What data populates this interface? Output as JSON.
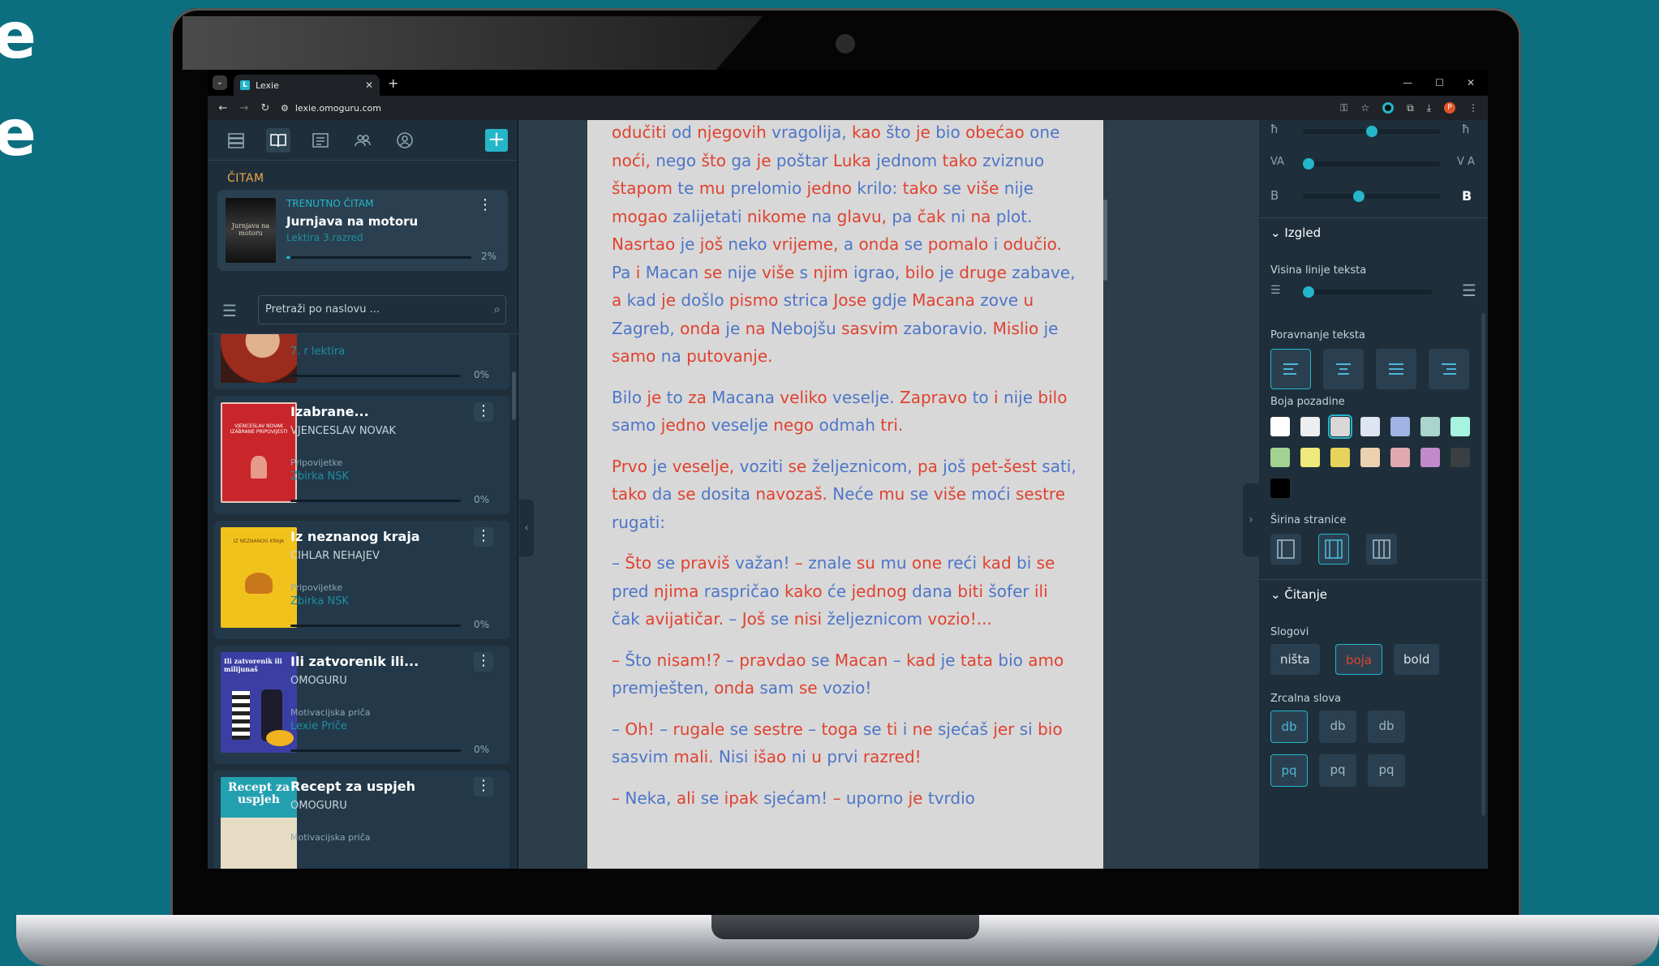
{
  "brand_colors": {
    "accent": "#25b6c9",
    "section_orange": "#f0a64a",
    "text_red": "#e0422f",
    "text_blue": "#4d76c8"
  },
  "browser": {
    "tab_title": "Lexie",
    "tab_favicon": "L",
    "url": "lexie.omoguru.com",
    "profile_initial": "P"
  },
  "sidebar": {
    "section_label": "ČITAM",
    "current": {
      "label": "TRENUTNO ČITAM",
      "title": "Jurnjava na motoru",
      "subtitle": "Lektira 3.razred",
      "progress": 2,
      "progress_label": "2%"
    },
    "search_placeholder": "Pretraži po naslovu ...",
    "books": [
      {
        "title": "",
        "author": "",
        "genre": "",
        "collection": "7. r lektira",
        "progress_label": "0%"
      },
      {
        "title": "Izabrane...",
        "author": "VJENCESLAV NOVAK",
        "genre": "Pripovijetke",
        "collection": "Zbirka NSK",
        "progress_label": "0%"
      },
      {
        "title": "Iz neznanog kraja",
        "author": "CIHLAR NEHAJEV",
        "genre": "Pripovijetke",
        "collection": "Zbirka NSK",
        "progress_label": "0%"
      },
      {
        "title": "Ili zatvorenik ili...",
        "author": "OMOGURU",
        "genre": "Motivacijska priča",
        "collection": "Lexie Priče",
        "progress_label": "0%"
      },
      {
        "title": "Recept za uspjeh",
        "author": "OMOGURU",
        "genre": "Motivacijska priča",
        "collection": "",
        "progress_label": ""
      }
    ],
    "cover_texts": {
      "current": "Jurnjava na motoru",
      "book2": "VJENCESLAV NOVAK IZABRANE PRIPOVIJESTI",
      "book3": "IZ NEZNANOG KRAJA",
      "book4": "Ili zatvorenik ili milijunaš",
      "book5": "Recept za uspjeh"
    }
  },
  "reader": {
    "paragraphs": [
      [
        "odučiti od njegovih vragolija, kao što je bio obećao one noći, nego što ga je poštar Luka jednom tako zviznuo štapom te mu prelomio jedno krilo: tako se više nije mogao zalijetati nikome na glavu, pa čak ni na plot. ",
        "Nasrtao je još neko vrijeme, a onda se pomalo i odučio. ",
        "Pa i Macan se nije više s njim igrao, bilo je druge zabave, a kad je došlo pismo strica Jose gdje Macana zove u Zagreb, onda je na Nebojšu sasvim zaboravio. ",
        "Mislio je samo na putovanje."
      ],
      [
        "Bilo je to za Macana veliko veselje. Zapravo to i nije bilo samo jedno veselje nego odmah tri."
      ],
      [
        "Prvo je veselje, voziti se željeznicom, pa još pet-šest sati, tako da se dosita navozaš. Neće mu se više moći sestre rugati:"
      ],
      [
        "– Što se praviš važan! – znale su mu one reći kad bi se pred njima raspričao kako će jednog dana biti šofer ili čak avijatičar. – Još se nisi željeznicom vozio!..."
      ],
      [
        "– Što nisam!? – pravdao se Macan – kad je tata bio amo premješten, onda sam se vozio!"
      ],
      [
        "– Oh! – rugale se sestre – toga se ti i ne sjećaš jer si bio sasvim mali. Nisi išao ni u prvi razred!"
      ],
      [
        "– Neka, ali se ipak sjećam! – uporno je tvrdio"
      ]
    ]
  },
  "panel": {
    "izgled": "Izgled",
    "line_height_label": "Visina linije teksta",
    "align_label": "Poravnanje teksta",
    "bg_label": "Boja pozadine",
    "width_label": "Širina stranice",
    "citanje": "Čitanje",
    "slogovi_label": "Slogovi",
    "slogovi_options": [
      "ništa",
      "boja",
      "bold"
    ],
    "mirror_label": "Zrcalna slova",
    "mirror_row1": [
      "db",
      "db",
      "db"
    ],
    "mirror_row2": [
      "pq",
      "pq",
      "pq"
    ],
    "slider_letters": {
      "h_left": "ħ",
      "h_right": "ħ",
      "va_left": "VA",
      "va_right": "V A",
      "b_left": "B",
      "b_right": "B"
    },
    "slider_levels": {
      "h": 0.5,
      "va": 0.0,
      "b": 0.4,
      "line_height": 0.0
    },
    "swatches": [
      "#ffffff",
      "#eceef0",
      "#d8d8d8",
      "#dfe4f2",
      "#9fb3e4",
      "#a9d5cc",
      "#a6f3df",
      "#a3d390",
      "#efea7c",
      "#e6d45c",
      "#ecd1b0",
      "#e2a8b0",
      "#c18bcb",
      "#3c3f41",
      "#000000"
    ],
    "selected_swatch": 2
  }
}
